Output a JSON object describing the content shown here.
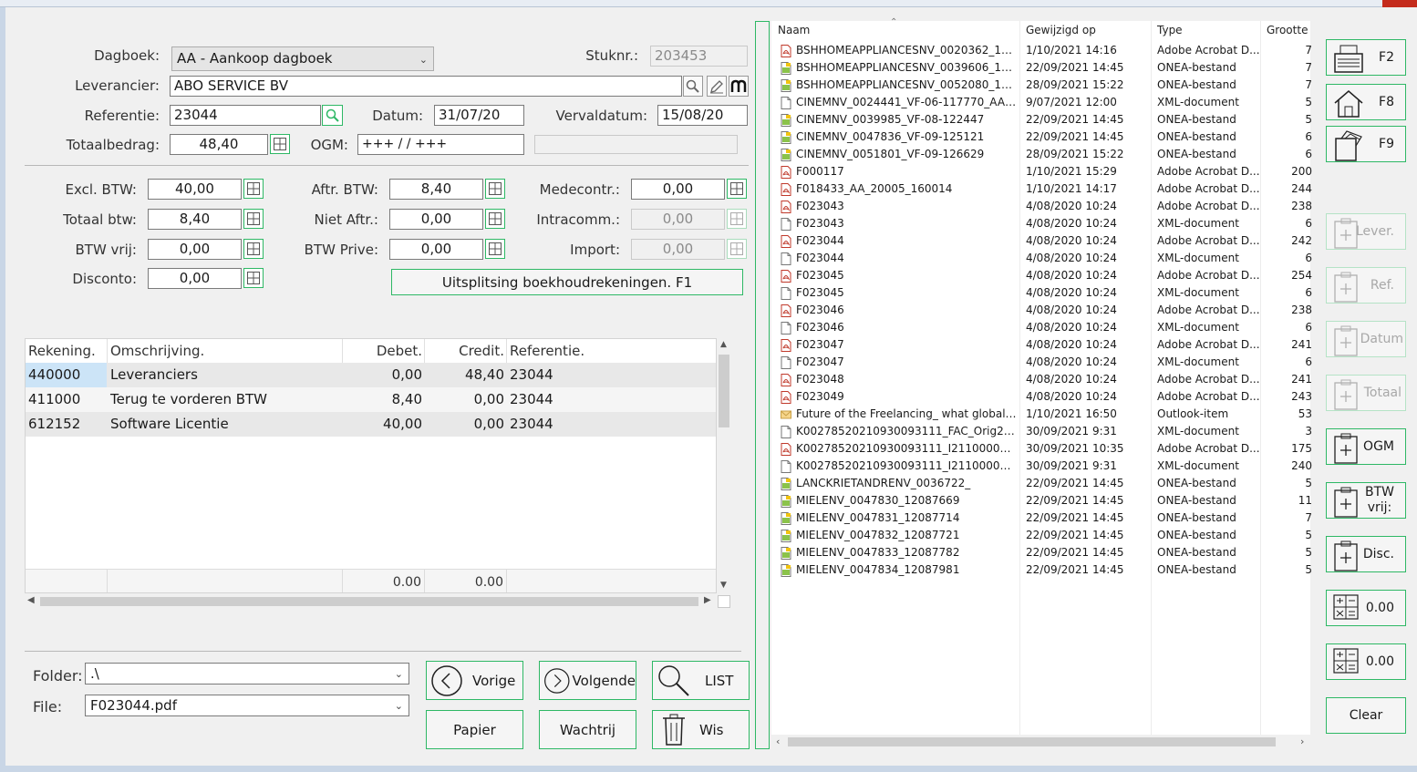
{
  "form": {
    "dagboek": {
      "label": "Dagboek:",
      "value": "AA - Aankoop dagboek"
    },
    "stuknr": {
      "label": "Stuknr.:",
      "value": "203453"
    },
    "leverancier": {
      "label": "Leverancier:",
      "value": "ABO SERVICE BV"
    },
    "referentie": {
      "label": "Referentie:",
      "value": "23044"
    },
    "datum": {
      "label": "Datum:",
      "value": "31/07/20"
    },
    "vervaldatum": {
      "label": "Vervaldatum:",
      "value": "15/08/20"
    },
    "totaalbedrag": {
      "label": "Totaalbedrag:",
      "value": "48,40"
    },
    "ogm": {
      "label": "OGM:",
      "value": "+++  /    /     +++"
    },
    "excl_btw": {
      "label": "Excl. BTW:",
      "value": "40,00"
    },
    "aftr_btw": {
      "label": "Aftr. BTW:",
      "value": "8,40"
    },
    "medecontr": {
      "label": "Medecontr.:",
      "value": "0,00"
    },
    "totaal_btw": {
      "label": "Totaal btw:",
      "value": "8,40"
    },
    "niet_aftr": {
      "label": "Niet Aftr.:",
      "value": "0,00"
    },
    "intracomm": {
      "label": "Intracomm.:",
      "value": "0,00"
    },
    "btw_vrij": {
      "label": "BTW vrij:",
      "value": "0,00"
    },
    "btw_prive": {
      "label": "BTW Prive:",
      "value": "0,00"
    },
    "import": {
      "label": "Import:",
      "value": "0,00"
    },
    "disconto": {
      "label": "Disconto:",
      "value": "0,00"
    },
    "split_button": "Uitsplitsing boekhoudrekeningen.  F1"
  },
  "grid": {
    "headers": [
      "Rekening.",
      "Omschrijving.",
      "Debet.",
      "Credit.",
      "Referentie."
    ],
    "rows": [
      {
        "rekening": "440000",
        "omschrijving": "Leveranciers",
        "debet": "0,00",
        "credit": "48,40",
        "referentie": "23044"
      },
      {
        "rekening": "411000",
        "omschrijving": "Terug te vorderen BTW",
        "debet": "8,40",
        "credit": "0,00",
        "referentie": "23044"
      },
      {
        "rekening": "612152",
        "omschrijving": "Software Licentie",
        "debet": "40,00",
        "credit": "0,00",
        "referentie": "23044"
      }
    ],
    "totals": {
      "debet": "0.00",
      "credit": "0.00"
    }
  },
  "bottom": {
    "folder_label": "Folder:",
    "folder_value": ".\\",
    "file_label": "File:",
    "file_value": "F023044.pdf",
    "vorige": "Vorige",
    "volgende": "Volgende",
    "list": "LIST",
    "papier": "Papier",
    "wachtrij": "Wachtrij",
    "wis": "Wis"
  },
  "filelist": {
    "headers": {
      "naam": "Naam",
      "gewijzigd": "Gewijzigd op",
      "type": "Type",
      "grootte": "Grootte"
    },
    "files": [
      {
        "icon": "pdf",
        "name": "BSHHOMEAPPLIANCESNV_0020362_118408...",
        "date": "1/10/2021 14:16",
        "type": "Adobe Acrobat D...",
        "size": "7"
      },
      {
        "icon": "onea",
        "name": "BSHHOMEAPPLIANCESNV_0039606_118412...",
        "date": "22/09/2021 14:45",
        "type": "ONEA-bestand",
        "size": "7"
      },
      {
        "icon": "onea",
        "name": "BSHHOMEAPPLIANCESNV_0052080_118415...",
        "date": "28/09/2021 15:22",
        "type": "ONEA-bestand",
        "size": "7"
      },
      {
        "icon": "xml",
        "name": "CINEMNV_0024441_VF-06-117770_AA_21009...",
        "date": "9/07/2021 12:00",
        "type": "XML-document",
        "size": "5"
      },
      {
        "icon": "onea",
        "name": "CINEMNV_0039985_VF-08-122447",
        "date": "22/09/2021 14:45",
        "type": "ONEA-bestand",
        "size": "5"
      },
      {
        "icon": "onea",
        "name": "CINEMNV_0047836_VF-09-125121",
        "date": "22/09/2021 14:45",
        "type": "ONEA-bestand",
        "size": "6"
      },
      {
        "icon": "onea",
        "name": "CINEMNV_0051801_VF-09-126629",
        "date": "28/09/2021 15:22",
        "type": "ONEA-bestand",
        "size": "6"
      },
      {
        "icon": "pdf",
        "name": "F000117",
        "date": "1/10/2021 15:29",
        "type": "Adobe Acrobat D...",
        "size": "200"
      },
      {
        "icon": "pdf",
        "name": "F018433_AA_20005_160014",
        "date": "1/10/2021 14:17",
        "type": "Adobe Acrobat D...",
        "size": "244"
      },
      {
        "icon": "pdf",
        "name": "F023043",
        "date": "4/08/2020 10:24",
        "type": "Adobe Acrobat D...",
        "size": "238"
      },
      {
        "icon": "xml",
        "name": "F023043",
        "date": "4/08/2020 10:24",
        "type": "XML-document",
        "size": "6"
      },
      {
        "icon": "pdf",
        "name": "F023044",
        "date": "4/08/2020 10:24",
        "type": "Adobe Acrobat D...",
        "size": "242"
      },
      {
        "icon": "xml",
        "name": "F023044",
        "date": "4/08/2020 10:24",
        "type": "XML-document",
        "size": "6"
      },
      {
        "icon": "pdf",
        "name": "F023045",
        "date": "4/08/2020 10:24",
        "type": "Adobe Acrobat D...",
        "size": "254"
      },
      {
        "icon": "xml",
        "name": "F023045",
        "date": "4/08/2020 10:24",
        "type": "XML-document",
        "size": "6"
      },
      {
        "icon": "pdf",
        "name": "F023046",
        "date": "4/08/2020 10:24",
        "type": "Adobe Acrobat D...",
        "size": "238"
      },
      {
        "icon": "xml",
        "name": "F023046",
        "date": "4/08/2020 10:24",
        "type": "XML-document",
        "size": "6"
      },
      {
        "icon": "pdf",
        "name": "F023047",
        "date": "4/08/2020 10:24",
        "type": "Adobe Acrobat D...",
        "size": "241"
      },
      {
        "icon": "xml",
        "name": "F023047",
        "date": "4/08/2020 10:24",
        "type": "XML-document",
        "size": "6"
      },
      {
        "icon": "pdf",
        "name": "F023048",
        "date": "4/08/2020 10:24",
        "type": "Adobe Acrobat D...",
        "size": "241"
      },
      {
        "icon": "pdf",
        "name": "F023049",
        "date": "4/08/2020 10:24",
        "type": "Adobe Acrobat D...",
        "size": "243"
      },
      {
        "icon": "mail",
        "name": "Future of the Freelancing_ what global stud...",
        "date": "1/10/2021 16:50",
        "type": "Outlook-item",
        "size": "53"
      },
      {
        "icon": "xml",
        "name": "K00278520210930093111_FAC_Orig2_FAK214...",
        "date": "30/09/2021 9:31",
        "type": "XML-document",
        "size": "3"
      },
      {
        "icon": "pdf",
        "name": "K00278520210930093111_I21100001805",
        "date": "30/09/2021 10:35",
        "type": "Adobe Acrobat D...",
        "size": "175"
      },
      {
        "icon": "xml",
        "name": "K00278520210930093111_I21100001805",
        "date": "30/09/2021 9:31",
        "type": "XML-document",
        "size": "240"
      },
      {
        "icon": "onea",
        "name": "LANCKRIETANDRENV_0036722_",
        "date": "22/09/2021 14:45",
        "type": "ONEA-bestand",
        "size": "5"
      },
      {
        "icon": "onea",
        "name": "MIELENV_0047830_12087669",
        "date": "22/09/2021 14:45",
        "type": "ONEA-bestand",
        "size": "11"
      },
      {
        "icon": "onea",
        "name": "MIELENV_0047831_12087714",
        "date": "22/09/2021 14:45",
        "type": "ONEA-bestand",
        "size": "7"
      },
      {
        "icon": "onea",
        "name": "MIELENV_0047832_12087721",
        "date": "22/09/2021 14:45",
        "type": "ONEA-bestand",
        "size": "5"
      },
      {
        "icon": "onea",
        "name": "MIELENV_0047833_12087782",
        "date": "22/09/2021 14:45",
        "type": "ONEA-bestand",
        "size": "5"
      },
      {
        "icon": "onea",
        "name": "MIELENV_0047834_12087981",
        "date": "22/09/2021 14:45",
        "type": "ONEA-bestand",
        "size": "5"
      }
    ]
  },
  "sidebar": {
    "f2": "F2",
    "f8": "F8",
    "f9": "F9",
    "lever": "Lever.",
    "ref": "Ref.",
    "datum": "Datum",
    "totaal": "Totaal",
    "ogm": "OGM",
    "btw_vrij_1": "BTW",
    "btw_vrij_2": "vrij:",
    "disc": "Disc.",
    "sum1": "0.00",
    "sum2": "0.00",
    "clear": "Clear"
  },
  "colors": {
    "accent": "#2eb865",
    "selection": "#cce4f7"
  }
}
